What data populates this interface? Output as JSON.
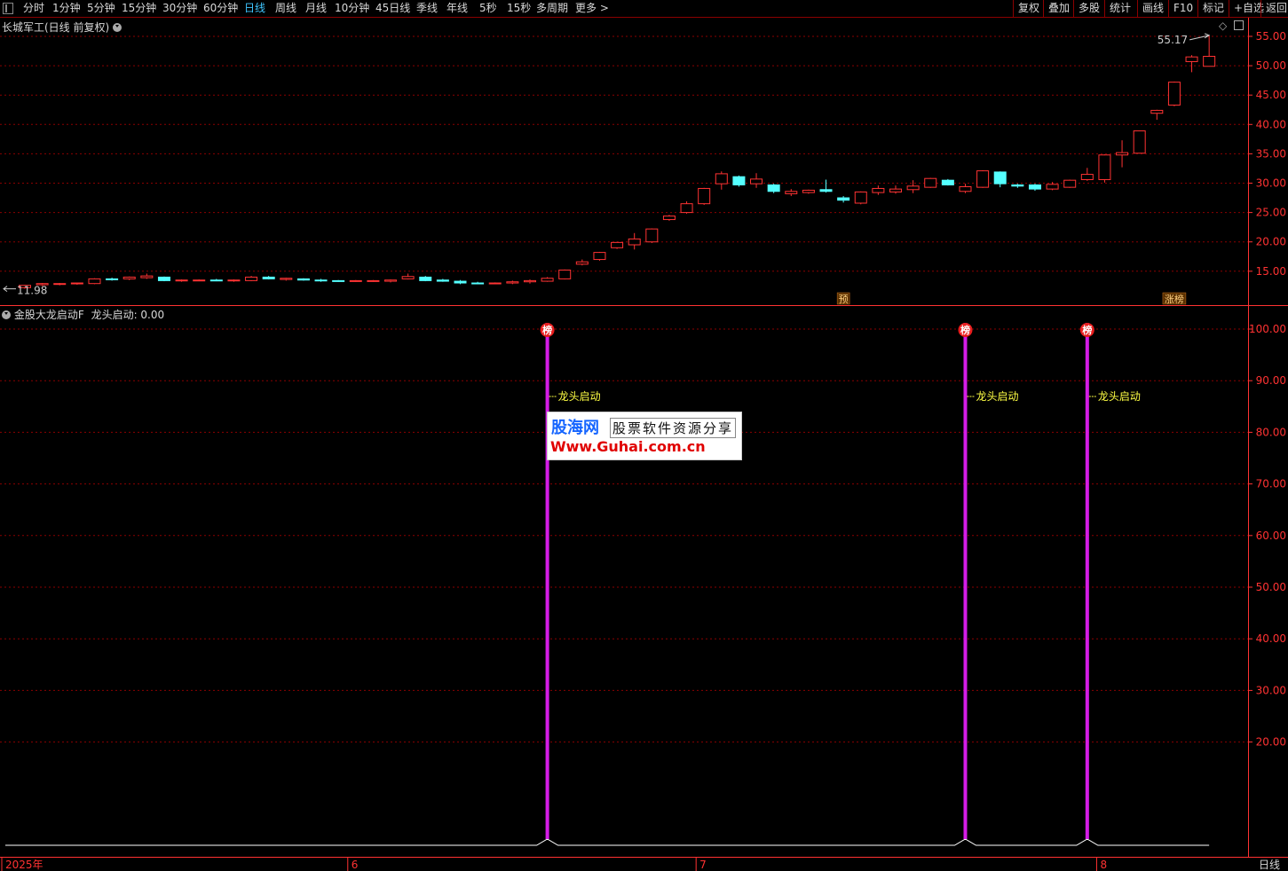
{
  "toolbar": {
    "periods": [
      "分时",
      "1分钟",
      "5分钟",
      "15分钟",
      "30分钟",
      "60分钟",
      "日线",
      "周线",
      "月线",
      "10分钟",
      "45日线",
      "季线",
      "年线",
      "5秒",
      "15秒",
      "多周期",
      "更多 >"
    ],
    "active_period": "日线",
    "right_buttons": [
      "复权",
      "叠加",
      "多股",
      "统计",
      "画线",
      "F10",
      "标记",
      "+自选",
      "返回"
    ]
  },
  "main_header": {
    "title": "长城军工(日线 前复权)"
  },
  "indicator_header": {
    "name": "金股大龙启动F",
    "value_label": "龙头启动: 0.00"
  },
  "colors": {
    "up": "#ff3333",
    "down": "#54ffff",
    "signal": "#d41ce6",
    "signal_text": "#ffff44",
    "axis": "#ff3232",
    "grid": "#8b0000"
  },
  "chart_data": [
    {
      "type": "candlestick",
      "title": "长城军工(日线 前复权)",
      "ylim": [
        10.5,
        57.5
      ],
      "y_ticks": [
        "55.00",
        "50.00",
        "45.00",
        "40.00",
        "35.00",
        "30.00",
        "25.00",
        "20.00",
        "15.00"
      ],
      "high_label": "55.17",
      "low_label": "11.98",
      "markers": [
        {
          "index": 47,
          "text": "预"
        },
        {
          "index": 66,
          "text": "涨榜"
        }
      ],
      "candles": [
        {
          "o": 12.2,
          "h": 12.7,
          "l": 12.0,
          "c": 12.6
        },
        {
          "o": 12.7,
          "h": 13.0,
          "l": 12.5,
          "c": 12.9
        },
        {
          "o": 12.8,
          "h": 13.0,
          "l": 12.6,
          "c": 12.9
        },
        {
          "o": 12.9,
          "h": 13.0,
          "l": 12.7,
          "c": 13.0
        },
        {
          "o": 12.9,
          "h": 13.8,
          "l": 12.8,
          "c": 13.7
        },
        {
          "o": 13.7,
          "h": 13.9,
          "l": 13.4,
          "c": 13.6
        },
        {
          "o": 13.7,
          "h": 14.1,
          "l": 13.5,
          "c": 14.0
        },
        {
          "o": 13.9,
          "h": 14.6,
          "l": 13.7,
          "c": 14.2
        },
        {
          "o": 14.0,
          "h": 14.1,
          "l": 13.3,
          "c": 13.4
        },
        {
          "o": 13.4,
          "h": 13.6,
          "l": 13.2,
          "c": 13.5
        },
        {
          "o": 13.5,
          "h": 13.6,
          "l": 13.3,
          "c": 13.5
        },
        {
          "o": 13.5,
          "h": 13.7,
          "l": 13.3,
          "c": 13.4
        },
        {
          "o": 13.4,
          "h": 13.6,
          "l": 13.2,
          "c": 13.5
        },
        {
          "o": 13.4,
          "h": 14.2,
          "l": 13.3,
          "c": 14.0
        },
        {
          "o": 14.0,
          "h": 14.2,
          "l": 13.6,
          "c": 13.7
        },
        {
          "o": 13.6,
          "h": 13.9,
          "l": 13.4,
          "c": 13.8
        },
        {
          "o": 13.7,
          "h": 13.8,
          "l": 13.4,
          "c": 13.5
        },
        {
          "o": 13.5,
          "h": 13.7,
          "l": 13.2,
          "c": 13.4
        },
        {
          "o": 13.4,
          "h": 13.5,
          "l": 13.2,
          "c": 13.3
        },
        {
          "o": 13.3,
          "h": 13.5,
          "l": 13.2,
          "c": 13.4
        },
        {
          "o": 13.3,
          "h": 13.5,
          "l": 13.2,
          "c": 13.4
        },
        {
          "o": 13.3,
          "h": 13.6,
          "l": 13.1,
          "c": 13.5
        },
        {
          "o": 13.7,
          "h": 14.6,
          "l": 13.6,
          "c": 14.1
        },
        {
          "o": 14.0,
          "h": 14.2,
          "l": 13.3,
          "c": 13.4
        },
        {
          "o": 13.5,
          "h": 13.7,
          "l": 13.2,
          "c": 13.3
        },
        {
          "o": 13.3,
          "h": 13.5,
          "l": 12.8,
          "c": 13.0
        },
        {
          "o": 13.0,
          "h": 13.2,
          "l": 12.8,
          "c": 12.9
        },
        {
          "o": 12.9,
          "h": 13.1,
          "l": 12.8,
          "c": 13.0
        },
        {
          "o": 13.0,
          "h": 13.4,
          "l": 12.8,
          "c": 13.2
        },
        {
          "o": 13.2,
          "h": 13.6,
          "l": 12.9,
          "c": 13.4
        },
        {
          "o": 13.3,
          "h": 14.0,
          "l": 13.2,
          "c": 13.8
        },
        {
          "o": 13.7,
          "h": 15.3,
          "l": 13.6,
          "c": 15.2
        },
        {
          "o": 16.2,
          "h": 17.0,
          "l": 16.0,
          "c": 16.6
        },
        {
          "o": 17.0,
          "h": 18.3,
          "l": 16.8,
          "c": 18.2
        },
        {
          "o": 19.0,
          "h": 20.0,
          "l": 18.8,
          "c": 19.9
        },
        {
          "o": 19.5,
          "h": 21.5,
          "l": 18.7,
          "c": 20.5
        },
        {
          "o": 20.0,
          "h": 22.3,
          "l": 19.8,
          "c": 22.2
        },
        {
          "o": 23.8,
          "h": 24.6,
          "l": 23.6,
          "c": 24.4
        },
        {
          "o": 25.0,
          "h": 26.9,
          "l": 24.8,
          "c": 26.5
        },
        {
          "o": 26.5,
          "h": 29.2,
          "l": 26.3,
          "c": 29.1
        },
        {
          "o": 29.9,
          "h": 32.0,
          "l": 28.9,
          "c": 31.6
        },
        {
          "o": 31.1,
          "h": 31.3,
          "l": 29.4,
          "c": 29.7
        },
        {
          "o": 29.9,
          "h": 31.7,
          "l": 29.2,
          "c": 30.7
        },
        {
          "o": 29.7,
          "h": 29.9,
          "l": 28.3,
          "c": 28.6
        },
        {
          "o": 28.2,
          "h": 29.0,
          "l": 27.8,
          "c": 28.6
        },
        {
          "o": 28.4,
          "h": 28.9,
          "l": 28.2,
          "c": 28.8
        },
        {
          "o": 28.9,
          "h": 30.6,
          "l": 28.4,
          "c": 28.6
        },
        {
          "o": 27.5,
          "h": 27.8,
          "l": 26.7,
          "c": 27.1
        },
        {
          "o": 26.6,
          "h": 28.6,
          "l": 26.4,
          "c": 28.5
        },
        {
          "o": 28.4,
          "h": 29.6,
          "l": 28.0,
          "c": 29.1
        },
        {
          "o": 28.5,
          "h": 29.6,
          "l": 28.2,
          "c": 29.0
        },
        {
          "o": 28.9,
          "h": 30.5,
          "l": 28.3,
          "c": 29.5
        },
        {
          "o": 29.3,
          "h": 30.9,
          "l": 29.2,
          "c": 30.8
        },
        {
          "o": 30.5,
          "h": 30.7,
          "l": 29.6,
          "c": 29.7
        },
        {
          "o": 28.6,
          "h": 29.9,
          "l": 28.3,
          "c": 29.4
        },
        {
          "o": 29.3,
          "h": 32.2,
          "l": 29.2,
          "c": 32.1
        },
        {
          "o": 31.9,
          "h": 32.0,
          "l": 29.3,
          "c": 29.9
        },
        {
          "o": 29.7,
          "h": 29.9,
          "l": 29.2,
          "c": 29.5
        },
        {
          "o": 29.7,
          "h": 29.9,
          "l": 28.7,
          "c": 29.0
        },
        {
          "o": 29.0,
          "h": 30.2,
          "l": 28.8,
          "c": 29.8
        },
        {
          "o": 29.3,
          "h": 30.6,
          "l": 29.2,
          "c": 30.5
        },
        {
          "o": 30.6,
          "h": 32.6,
          "l": 30.4,
          "c": 31.5
        },
        {
          "o": 30.6,
          "h": 34.9,
          "l": 30.1,
          "c": 34.8
        },
        {
          "o": 34.8,
          "h": 37.3,
          "l": 32.7,
          "c": 35.2
        },
        {
          "o": 35.1,
          "h": 38.9,
          "l": 35.1,
          "c": 38.9
        },
        {
          "o": 41.9,
          "h": 42.5,
          "l": 40.8,
          "c": 42.4
        },
        {
          "o": 43.3,
          "h": 47.3,
          "l": 43.1,
          "c": 47.2
        },
        {
          "o": 50.7,
          "h": 51.8,
          "l": 48.9,
          "c": 51.5
        },
        {
          "o": 49.9,
          "h": 55.17,
          "l": 49.9,
          "c": 51.6
        }
      ]
    },
    {
      "type": "line",
      "series_label": "龙头启动",
      "ylim": [
        0,
        106
      ],
      "y_ticks": [
        "100.00",
        "90.00",
        "80.00",
        "70.00",
        "60.00",
        "50.00",
        "40.00",
        "30.00",
        "20.00"
      ],
      "signal_label": "龙头启动",
      "signal_badge": "榜",
      "signal_indices": [
        30,
        54,
        61
      ],
      "signal_value": 100,
      "baseline_value": 0
    }
  ],
  "x_axis": {
    "labels": [
      {
        "index": 0,
        "text": "2025年"
      },
      {
        "index": 19,
        "text": "6"
      },
      {
        "index": 39,
        "text": "7"
      },
      {
        "index": 62,
        "text": "8"
      }
    ],
    "period": "日线"
  },
  "watermark": {
    "line1": "股海网",
    "line2": "股票软件资源分享",
    "line3": "Www.Guhai.com.cn"
  }
}
